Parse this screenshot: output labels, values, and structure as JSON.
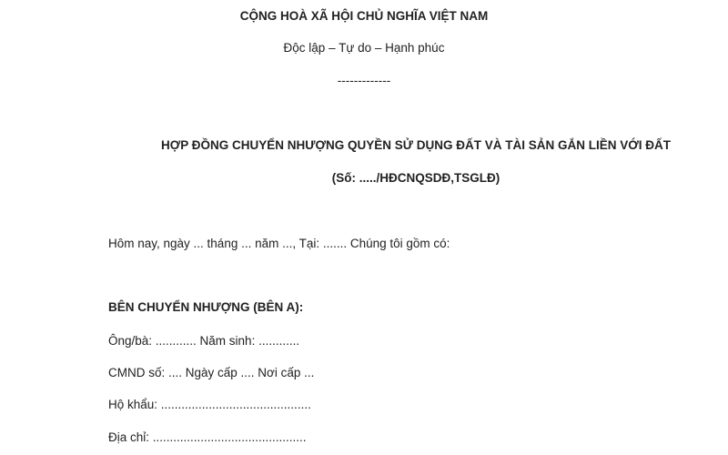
{
  "header": {
    "nation": "CỘNG HOÀ XÃ HỘI CHỦ NGHĨA VIỆT NAM",
    "motto": "Độc lập – Tự do – Hạnh phúc",
    "separator": "-------------"
  },
  "title": {
    "main": "HỢP ĐỒNG CHUYỂN NHƯỢNG QUYỀN SỬ DỤNG ĐẤT VÀ TÀI SẢN GẮN LIỀN VỚI ĐẤT",
    "number": "(Số: ...../HĐCNQSDĐ,TSGLĐ)"
  },
  "body": {
    "intro": "Hôm nay, ngày ...  tháng ... năm ..., Tại: ....... Chúng tôi gồm có:",
    "party_a_heading": "BÊN CHUYỂN NHƯỢNG (BÊN A):",
    "fields": [
      "Ông/bà: ............ Năm sinh: ............",
      "CMND số: .... Ngày cấp .... Nơi cấp ...",
      "Hộ khẩu: ............................................",
      "Địa chỉ: ............................................."
    ]
  }
}
